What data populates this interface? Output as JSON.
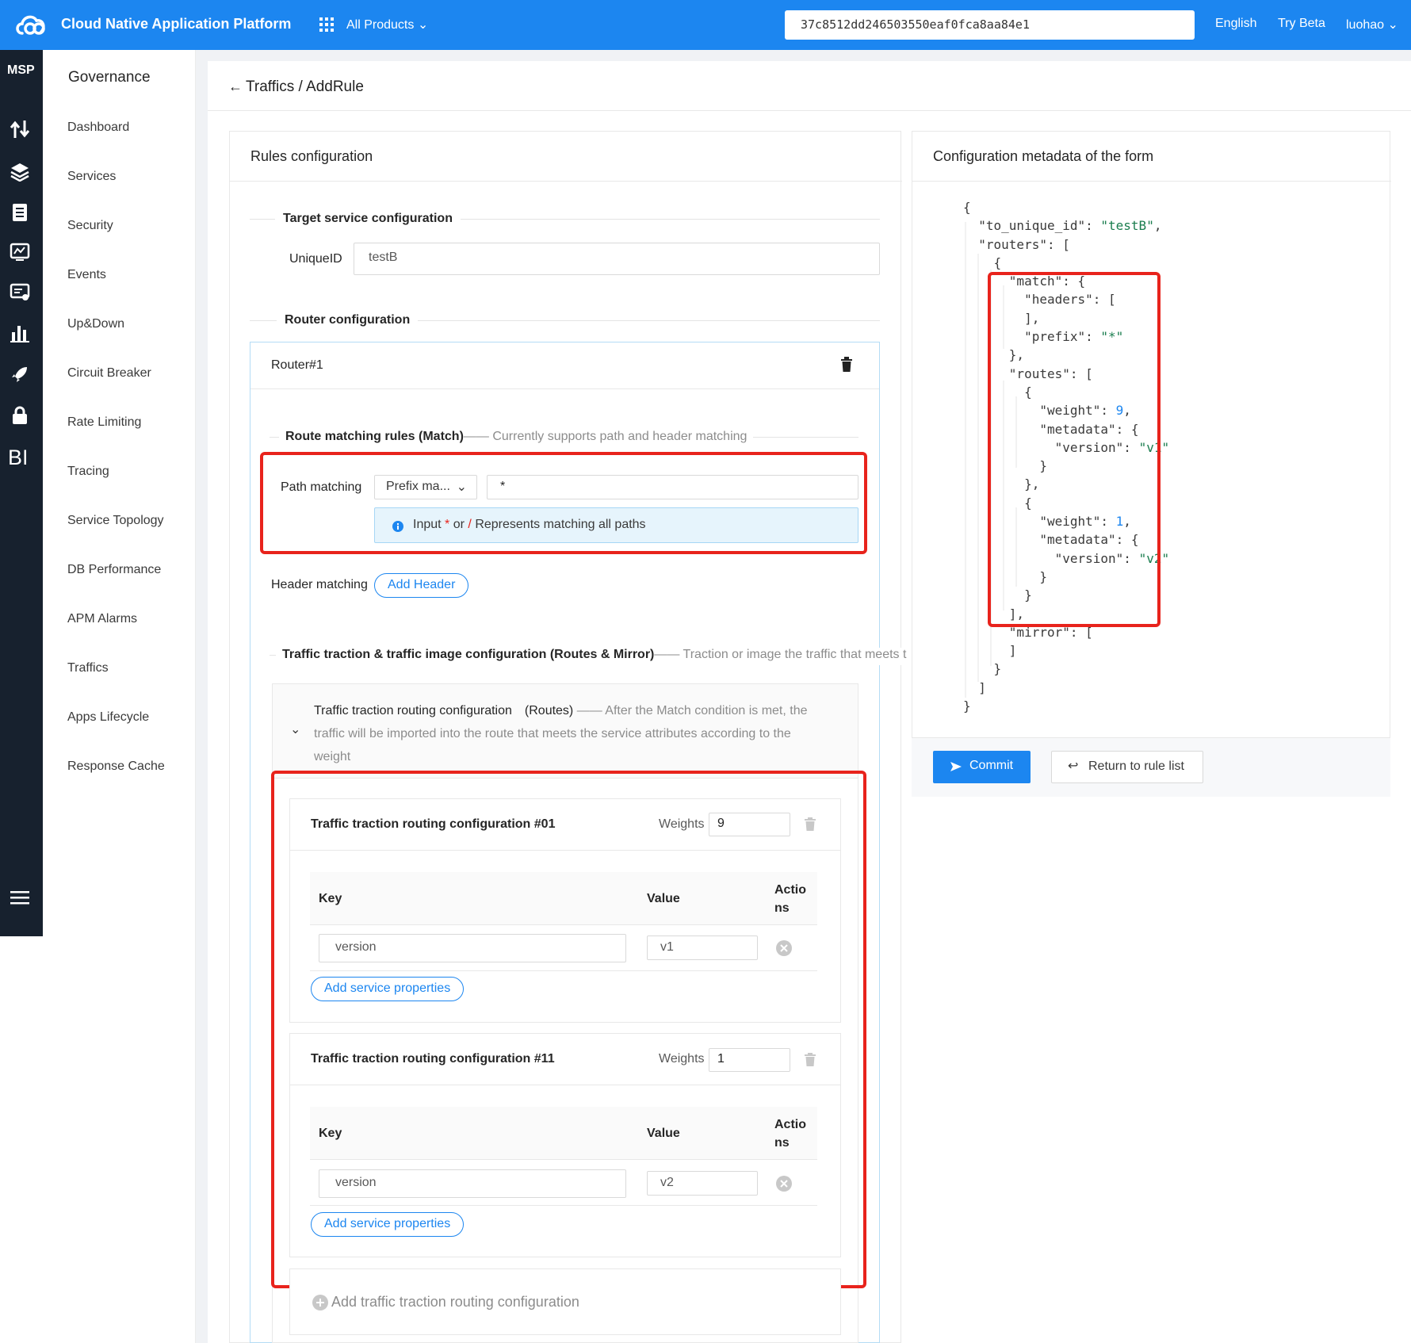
{
  "topbar": {
    "brand": "Cloud Native Application Platform",
    "all_products": "All Products",
    "search_value": "37c8512dd246503550eaf0fca8aa84e1",
    "language": "English",
    "try_beta": "Try Beta",
    "user": "luohao"
  },
  "rail": {
    "msp": "MSP",
    "bi": "BI",
    "icons": [
      "arrows-icon",
      "layers-icon",
      "clipboard-icon",
      "monitor-icon",
      "chat-list-icon",
      "bar-chart-icon",
      "rocket-icon",
      "lock-icon",
      "menu-icon"
    ]
  },
  "nav": {
    "heading": "Governance",
    "items": [
      "Dashboard",
      "Services",
      "Security",
      "Events",
      "Up&Down",
      "Circuit Breaker",
      "Rate Limiting",
      "Tracing",
      "Service Topology",
      "DB Performance",
      "APM Alarms",
      "Traffics",
      "Apps Lifecycle",
      "Response Cache"
    ]
  },
  "breadcrumb": "Traffics / AddRule",
  "rules": {
    "title": "Rules configuration",
    "target_section": "Target service configuration",
    "uniqueid_label": "UniqueID",
    "uniqueid_value": "testB",
    "router_section": "Router configuration",
    "router_name": "Router#1",
    "match_title": "Route matching rules (Match)",
    "match_hint": "—— Currently supports path and header matching",
    "path_label": "Path matching",
    "path_mode": "Prefix ma...",
    "path_value": "*",
    "info_input": "Input",
    "info_star": "*",
    "info_or": "or",
    "info_slash": "/",
    "info_rest": "Represents matching all paths",
    "header_label": "Header matching",
    "add_header": "Add Header",
    "routes_title": "Traffic traction & traffic image configuration (Routes & Mirror)",
    "routes_hint": "—— Traction or image the traffic that meets t",
    "routes_sub_title": "Traffic traction routing configuration　(Routes)",
    "routes_sub_hint": " —— After the Match condition is met, the",
    "routes_sub_line2": "traffic will be imported into the route that meets the service attributes according to the",
    "routes_sub_line3": "weight",
    "routes": [
      {
        "title": "Traffic traction routing configuration #01",
        "weights_label": "Weights",
        "weight": "9",
        "col_key": "Key",
        "col_value": "Value",
        "col_actions_1": "Actio",
        "col_actions_2": "ns",
        "key": "version",
        "value": "v1",
        "add_props": "Add service properties"
      },
      {
        "title": "Traffic traction routing configuration #11",
        "weights_label": "Weights",
        "weight": "1",
        "col_key": "Key",
        "col_value": "Value",
        "col_actions_1": "Actio",
        "col_actions_2": "ns",
        "key": "version",
        "value": "v2",
        "add_props": "Add service properties"
      }
    ],
    "add_route": "Add traffic traction routing configuration"
  },
  "metadata": {
    "title": "Configuration metadata of the form",
    "commit": "Commit",
    "return": "Return to rule list",
    "json": [
      "{",
      "  \"to_unique_id\": \"testB\",",
      "  \"routers\": [",
      "    {",
      "      \"match\": {",
      "        \"headers\": [",
      "        ],",
      "        \"prefix\": \"*\"",
      "      },",
      "      \"routes\": [",
      "        {",
      "          \"weight\": 9,",
      "          \"metadata\": {",
      "            \"version\": \"v1\"",
      "          }",
      "        },",
      "        {",
      "          \"weight\": 1,",
      "          \"metadata\": {",
      "            \"version\": \"v2\"",
      "          }",
      "        }",
      "      ],",
      "      \"mirror\": [",
      "      ]",
      "    }",
      "  ]",
      "}"
    ]
  },
  "colors": {
    "accent": "#1c86f0",
    "rail": "#17212e",
    "highlight": "#e8231c"
  }
}
